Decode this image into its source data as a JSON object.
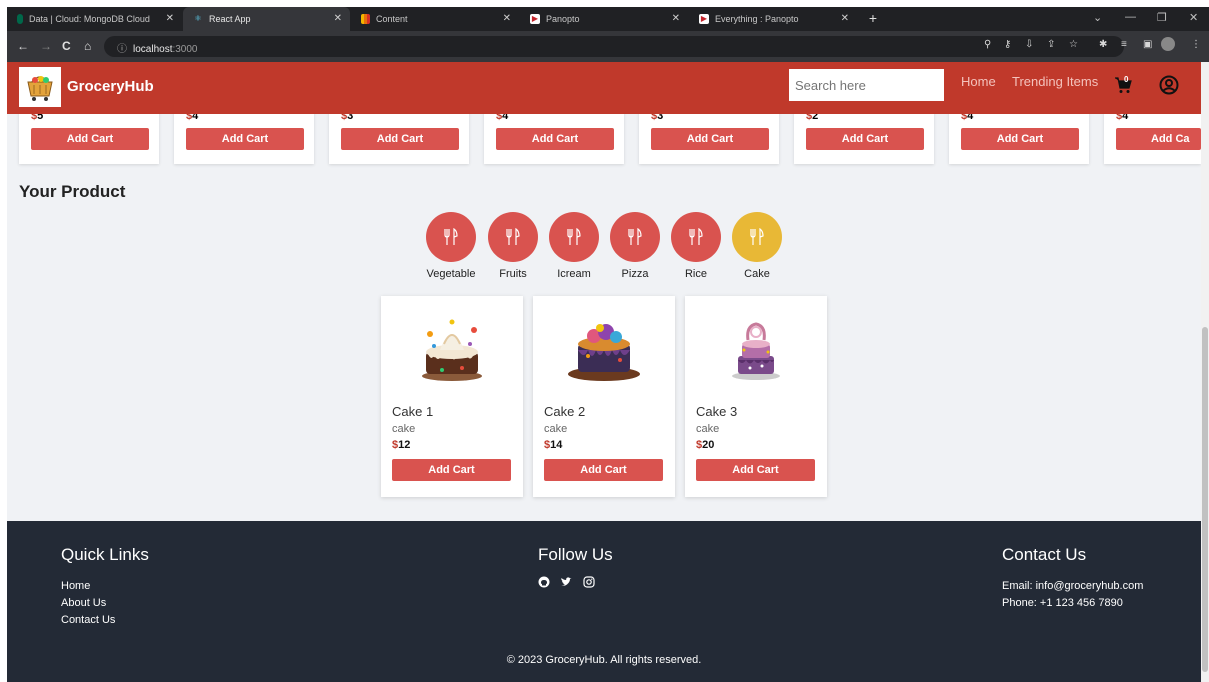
{
  "browser": {
    "tabs": [
      {
        "title": "Data | Cloud: MongoDB Cloud",
        "active": false
      },
      {
        "title": "React App",
        "active": true
      },
      {
        "title": "Content",
        "active": false
      },
      {
        "title": "Panopto",
        "active": false
      },
      {
        "title": "Everything : Panopto",
        "active": false
      }
    ],
    "url_host": "localhost",
    "url_port": ":3000"
  },
  "navbar": {
    "brand": "GroceryHub",
    "search_placeholder": "Search here",
    "links": [
      "Home",
      "Trending Items"
    ],
    "cart_count": "0"
  },
  "trending": {
    "items": [
      {
        "price": "5",
        "button": "Add Cart"
      },
      {
        "price": "4",
        "button": "Add Cart"
      },
      {
        "price": "3",
        "button": "Add Cart"
      },
      {
        "price": "4",
        "button": "Add Cart"
      },
      {
        "price": "3",
        "button": "Add Cart"
      },
      {
        "price": "2",
        "button": "Add Cart"
      },
      {
        "price": "4",
        "button": "Add Cart"
      },
      {
        "price": "4",
        "button": "Add Ca"
      }
    ]
  },
  "your_product": {
    "heading": "Your Product",
    "categories": [
      {
        "label": "Vegetable",
        "selected": false
      },
      {
        "label": "Fruits",
        "selected": false
      },
      {
        "label": "Icream",
        "selected": false
      },
      {
        "label": "Pizza",
        "selected": false
      },
      {
        "label": "Rice",
        "selected": false
      },
      {
        "label": "Cake",
        "selected": true
      }
    ],
    "products": [
      {
        "name": "Cake 1",
        "category": "cake",
        "price": "12",
        "button": "Add Cart"
      },
      {
        "name": "Cake 2",
        "category": "cake",
        "price": "14",
        "button": "Add Cart"
      },
      {
        "name": "Cake 3",
        "category": "cake",
        "price": "20",
        "button": "Add Cart"
      }
    ]
  },
  "footer": {
    "quick_links_title": "Quick Links",
    "quick_links": [
      "Home",
      "About Us",
      "Contact Us"
    ],
    "follow_title": "Follow Us",
    "contact_title": "Contact Us",
    "email": "Email: info@groceryhub.com",
    "phone": "Phone: +1 123 456 7890",
    "copyright": "© 2023 GroceryHub. All rights reserved."
  },
  "colors": {
    "primary": "#c0392b",
    "button": "#d9534f",
    "selected_category": "#e8b836",
    "footer_bg": "#232a36"
  },
  "icons": [
    "fork-knife-icon",
    "cart-icon",
    "user-circle-icon",
    "github-icon",
    "twitter-icon",
    "instagram-icon"
  ]
}
